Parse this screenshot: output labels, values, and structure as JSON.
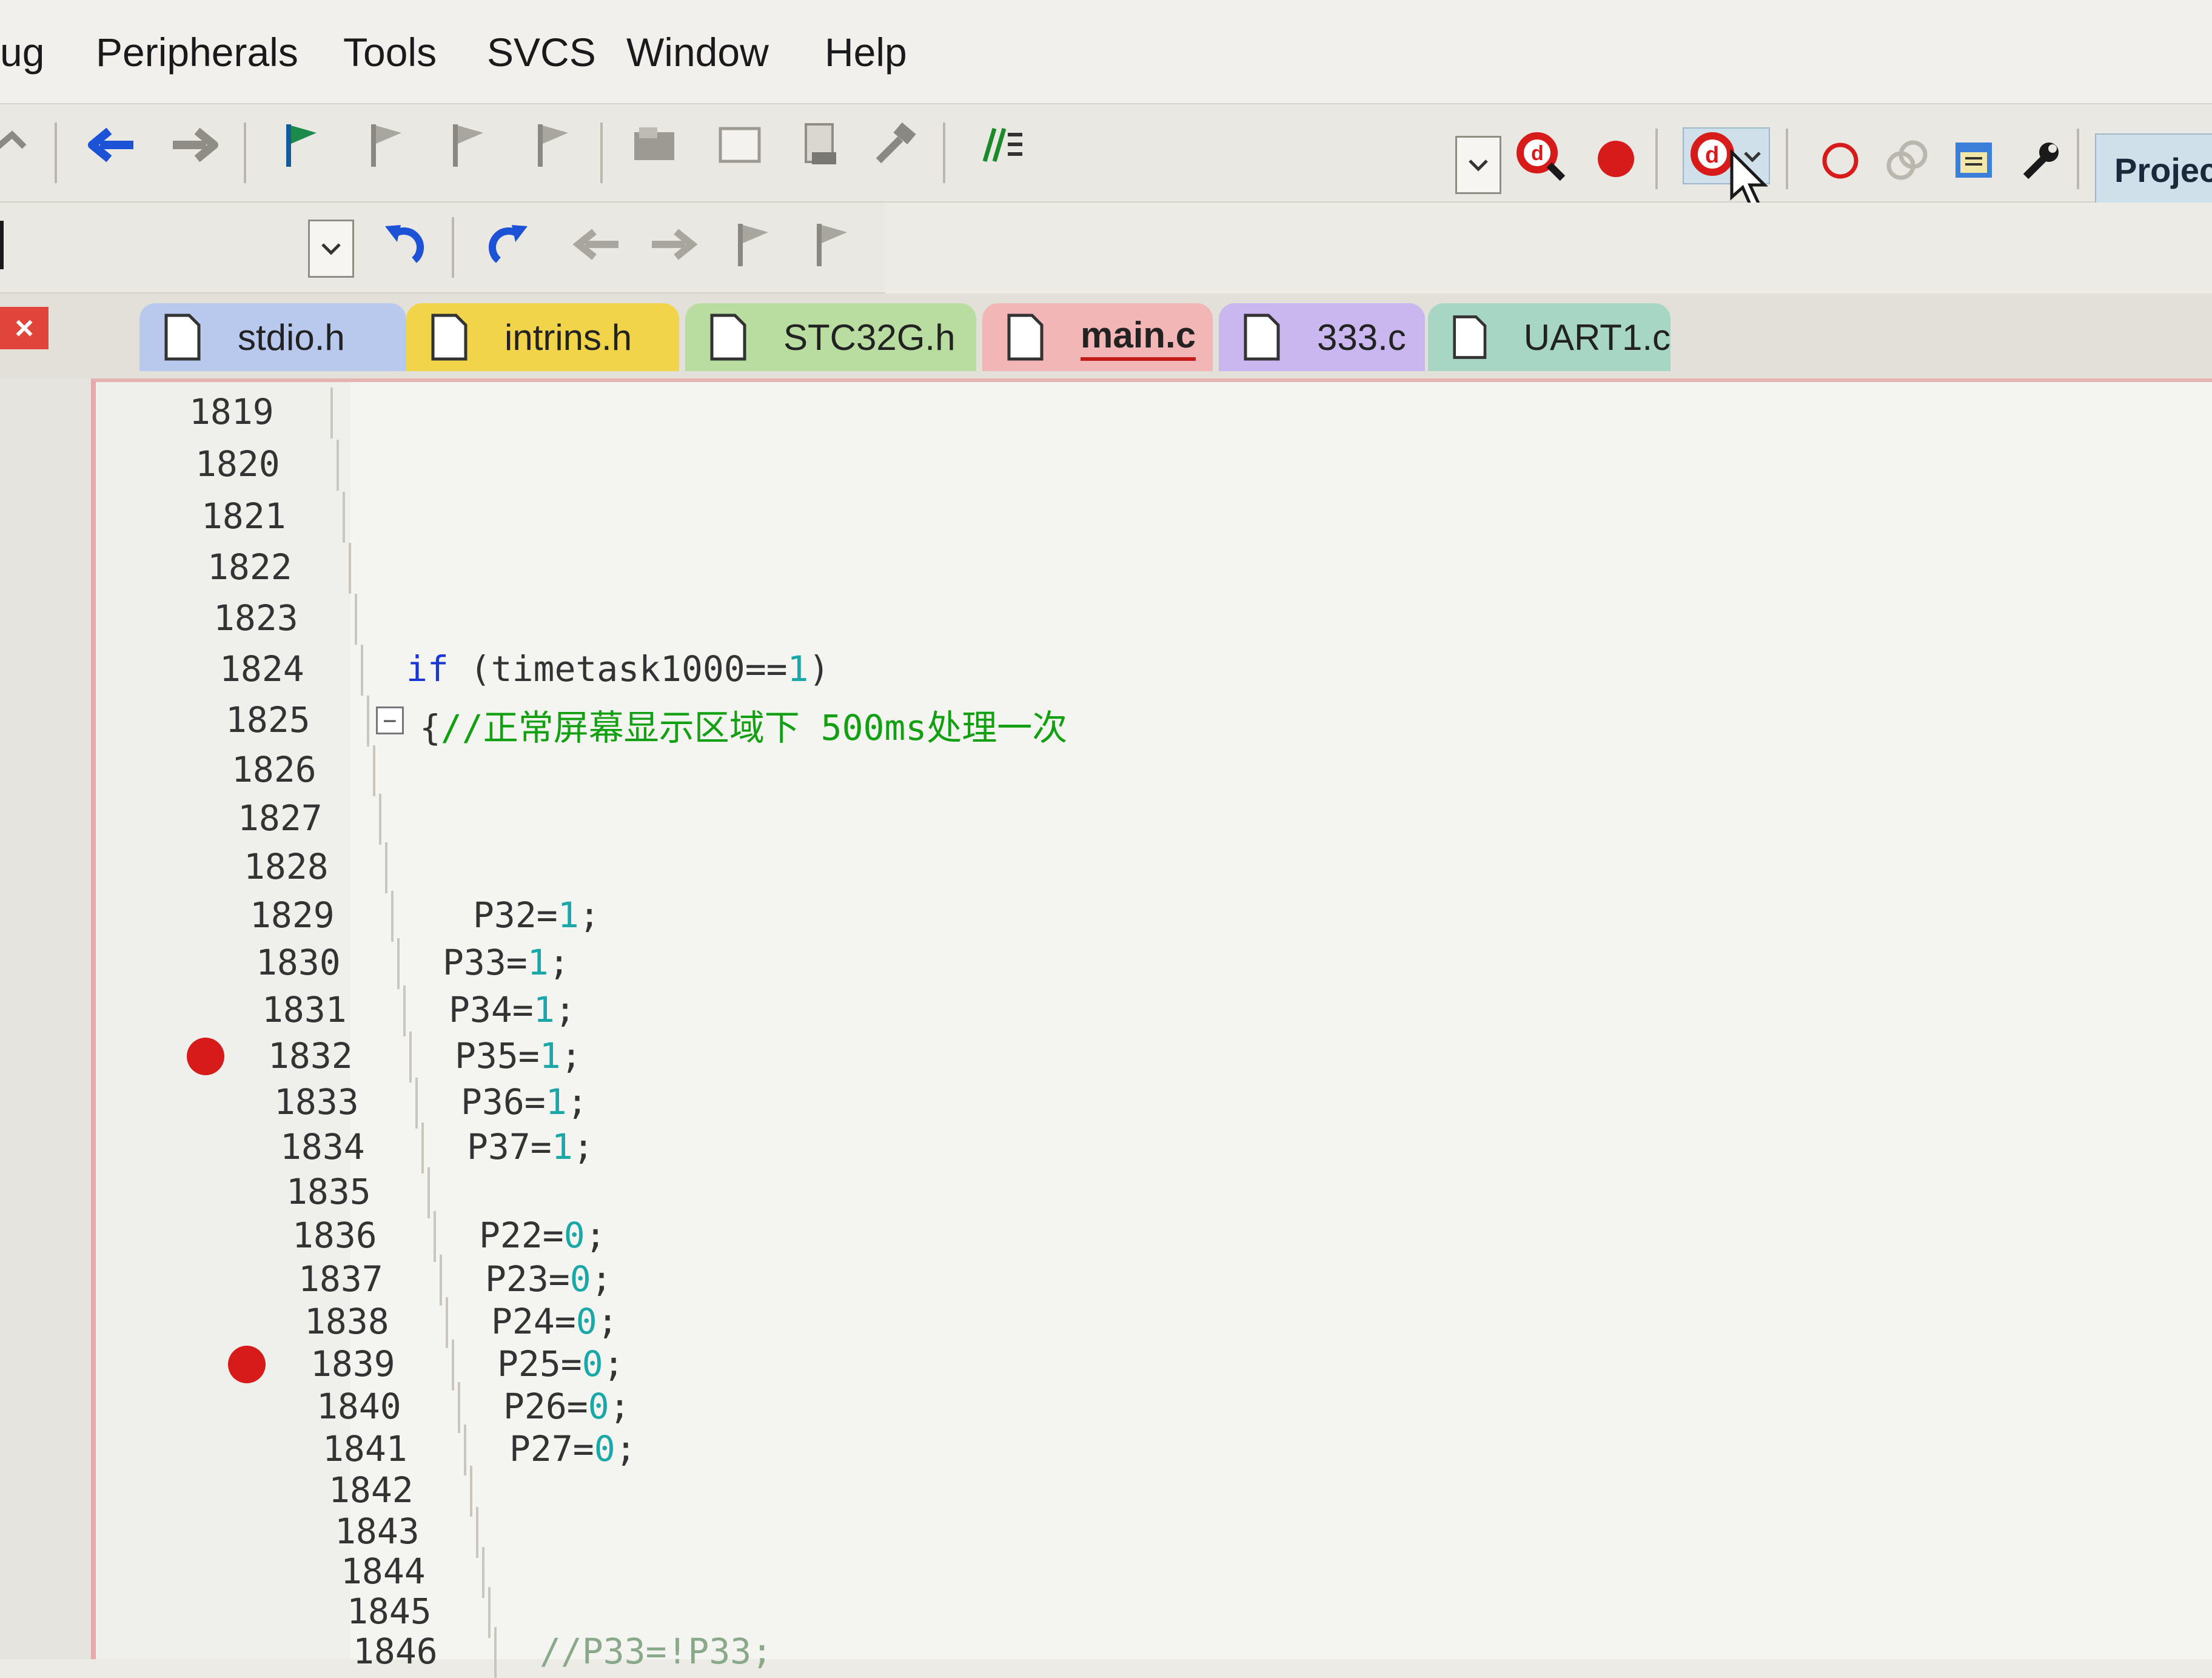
{
  "menu": [
    "ug",
    "Peripherals",
    "Tools",
    "SVCS",
    "Window",
    "Help"
  ],
  "toolbar": {
    "project_label": "Project"
  },
  "tabs": [
    {
      "label": "stdio.h",
      "color": "#b9c9ee"
    },
    {
      "label": "intrins.h",
      "color": "#f2d44a"
    },
    {
      "label": "STC32G.h",
      "color": "#b9dca0"
    },
    {
      "label": "main.c",
      "color": "#f3b6b6",
      "active": true
    },
    {
      "label": "333.c",
      "color": "#cbb7ef"
    },
    {
      "label": "UART1.c",
      "color": "#a7d7c4"
    }
  ],
  "close_label": "×",
  "colors": {
    "keyword": "#1a36d8",
    "number": "#1aa7a7",
    "comment": "#12a012",
    "breakpoint": "#d71a1a"
  },
  "editor": {
    "lines": [
      {
        "n": "1819",
        "code": ""
      },
      {
        "n": "1820",
        "code": ""
      },
      {
        "n": "1821",
        "code": ""
      },
      {
        "n": "1822",
        "code": ""
      },
      {
        "n": "1823",
        "code": ""
      },
      {
        "n": "1824",
        "code": "if (timetask1000==1)"
      },
      {
        "n": "1825",
        "code": "{//正常屏幕显示区域下 500ms处理一次"
      },
      {
        "n": "1826",
        "code": ""
      },
      {
        "n": "1827",
        "code": ""
      },
      {
        "n": "1828",
        "code": ""
      },
      {
        "n": "1829",
        "code": "P32=1;"
      },
      {
        "n": "1830",
        "code": "P33=1;"
      },
      {
        "n": "1831",
        "code": "P34=1;"
      },
      {
        "n": "1832",
        "code": "P35=1;",
        "breakpoint": true
      },
      {
        "n": "1833",
        "code": "P36=1;"
      },
      {
        "n": "1834",
        "code": "P37=1;"
      },
      {
        "n": "1835",
        "code": ""
      },
      {
        "n": "1836",
        "code": "P22=0;"
      },
      {
        "n": "1837",
        "code": "P23=0;"
      },
      {
        "n": "1838",
        "code": "P24=0;"
      },
      {
        "n": "1839",
        "code": "P25=0;",
        "breakpoint": true
      },
      {
        "n": "1840",
        "code": "P26=0;"
      },
      {
        "n": "1841",
        "code": "P27=0;"
      },
      {
        "n": "1842",
        "code": ""
      },
      {
        "n": "1843",
        "code": ""
      },
      {
        "n": "1844",
        "code": ""
      },
      {
        "n": "1845",
        "code": ""
      },
      {
        "n": "1846",
        "code": "//P33=!P33;"
      }
    ],
    "kw_if": "if",
    "cond_text": " (timetask1000==",
    "cond_num": "1",
    "cond_close": ")",
    "brace": "{",
    "comment_1825": "//正常屏幕显示区域下 500ms处理一次",
    "fold_marker": "−"
  }
}
